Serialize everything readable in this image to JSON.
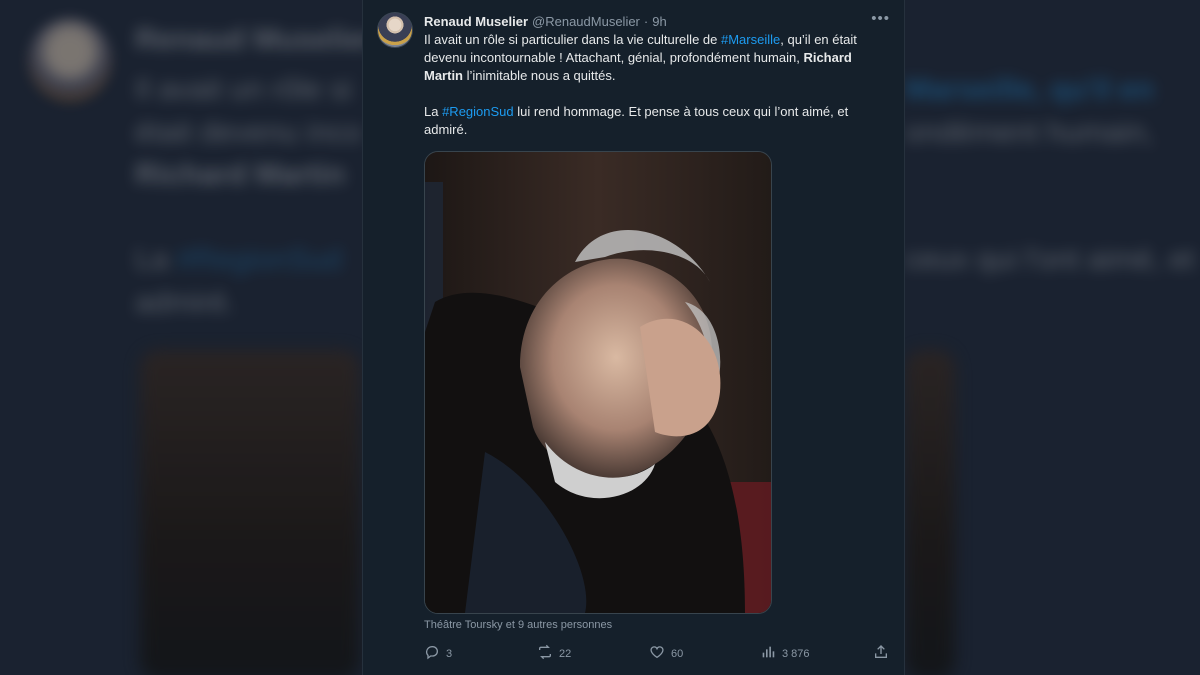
{
  "tweet": {
    "author_name": "Renaud Muselier",
    "handle": "@RenaudMuselier",
    "separator": "·",
    "time": "9h",
    "more_icon": "more-horizontal-icon",
    "text": {
      "p1_a": "Il avait un rôle si particulier dans la vie culturelle de ",
      "hashtag_1": "#Marseille",
      "p1_b": ", qu’il en était devenu incontournable ! Attachant, génial, profondément humain, ",
      "person": "Richard Martin",
      "p1_c": " l’inimitable nous a quittés.",
      "p2_a": "La ",
      "hashtag_2": "#RegionSud",
      "p2_b": " lui rend hommage. Et pense à tous ceux qui l’ont aimé, et admiré."
    },
    "tagged": "Théâtre Toursky et 9 autres personnes",
    "actions": {
      "replies": "3",
      "retweets": "22",
      "likes": "60",
      "views": "3 876"
    },
    "colors": {
      "accent": "#1d9bf0",
      "background": "#15202b",
      "text": "#e7e9ea",
      "muted": "#8b98a5"
    }
  }
}
